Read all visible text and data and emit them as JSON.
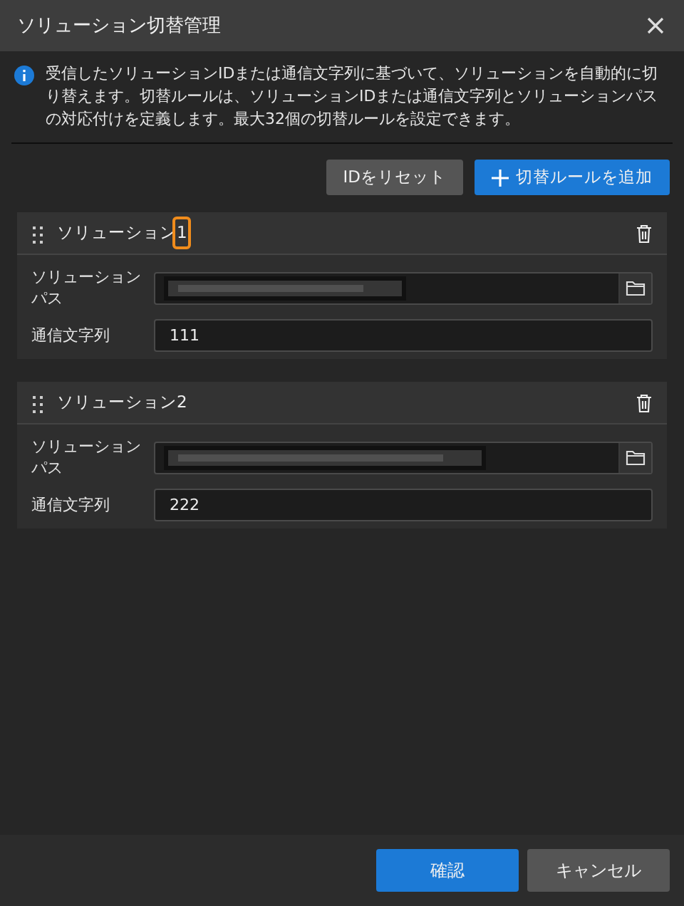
{
  "window": {
    "title": "ソリューション切替管理"
  },
  "info": "受信したソリューションIDまたは通信文字列に基づいて、ソリューションを自動的に切り替えます。切替ルールは、ソリューションIDまたは通信文字列とソリューションパスの対応付けを定義します。最大32個の切替ルールを設定できます。",
  "toolbar": [
    {
      "label": "IDをリセット",
      "kind": "secondary"
    },
    {
      "label": "切替ルールを追加",
      "kind": "add"
    }
  ],
  "rules": [
    {
      "name": "ソリューション1",
      "highlighted": true,
      "fields": [
        {
          "label": "ソリューションパス",
          "kind": "path"
        },
        {
          "label": "通信文字列",
          "kind": "text",
          "value": "111"
        }
      ]
    },
    {
      "name": "ソリューション2",
      "highlighted": false,
      "fields": [
        {
          "label": "ソリューションパス",
          "kind": "path"
        },
        {
          "label": "通信文字列",
          "kind": "text",
          "value": "222"
        }
      ]
    }
  ],
  "buttons": [
    {
      "label": "確認",
      "kind": "primary"
    },
    {
      "label": "キャンセル",
      "kind": "secondary"
    }
  ]
}
